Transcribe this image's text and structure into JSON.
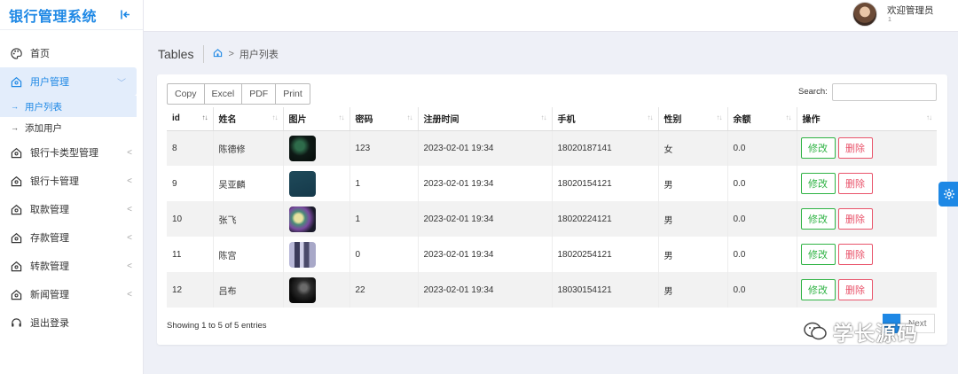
{
  "brand": {
    "title": "银行管理系统"
  },
  "sidebar": {
    "items": [
      {
        "label": "首页"
      },
      {
        "label": "用户管理"
      },
      {
        "label": "银行卡类型管理"
      },
      {
        "label": "银行卡管理"
      },
      {
        "label": "取款管理"
      },
      {
        "label": "存款管理"
      },
      {
        "label": "转款管理"
      },
      {
        "label": "新闻管理"
      },
      {
        "label": "退出登录"
      }
    ],
    "subitems": [
      {
        "label": "用户列表"
      },
      {
        "label": "添加用户"
      }
    ]
  },
  "topbar": {
    "welcome": "欢迎管理员",
    "user_id": "1"
  },
  "breadcrumb": {
    "title": "Tables",
    "current": "用户列表"
  },
  "toolbar": {
    "copy": "Copy",
    "excel": "Excel",
    "pdf": "PDF",
    "print": "Print"
  },
  "search": {
    "label": "Search:",
    "value": ""
  },
  "table": {
    "headers": [
      "id",
      "姓名",
      "图片",
      "密码",
      "注册时间",
      "手机",
      "性别",
      "余额",
      "操作"
    ],
    "rows": [
      {
        "id": "8",
        "name": "陈德修",
        "password": "123",
        "time": "2023-02-01 19:34",
        "phone": "18020187141",
        "gender": "女",
        "balance": "0.0"
      },
      {
        "id": "9",
        "name": "吴亚麟",
        "password": "1",
        "time": "2023-02-01 19:34",
        "phone": "18020154121",
        "gender": "男",
        "balance": "0.0"
      },
      {
        "id": "10",
        "name": "张飞",
        "password": "1",
        "time": "2023-02-01 19:34",
        "phone": "18020224121",
        "gender": "男",
        "balance": "0.0"
      },
      {
        "id": "11",
        "name": "陈宫",
        "password": "0",
        "time": "2023-02-01 19:34",
        "phone": "18020254121",
        "gender": "男",
        "balance": "0.0"
      },
      {
        "id": "12",
        "name": "吕布",
        "password": "22",
        "time": "2023-02-01 19:34",
        "phone": "18030154121",
        "gender": "男",
        "balance": "0.0"
      }
    ],
    "edit_label": "修改",
    "delete_label": "删除"
  },
  "footer": {
    "info": "Showing 1 to 5 of 5 entries",
    "next": "Next"
  },
  "watermark": {
    "text": "学长源码"
  },
  "colors": {
    "primary": "#1e88e5",
    "success": "#2fb344",
    "danger": "#e9546b"
  }
}
